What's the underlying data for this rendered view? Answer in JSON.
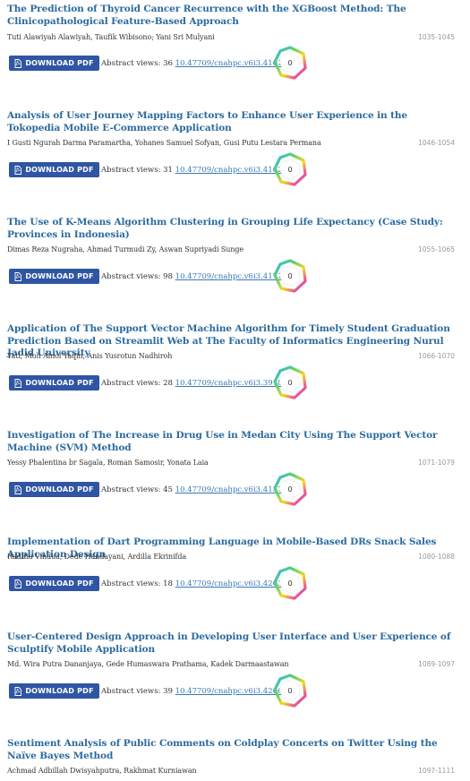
{
  "download_label": "DOWNLOAD PDF",
  "abstract_views_label": "Abstract views:",
  "articles": [
    {
      "title": "The Prediction of Thyroid Cancer Recurrence with the XGBoost Method: The Clinicopathological Feature-Based Approach",
      "authors": "Tuti Alawiyah Alawiyah, Taufik Wibisono; Yani Sri Mulyani",
      "pages": "1035-1045",
      "views": "36",
      "doi": "10.47709/cnahpc.v6i3.4101",
      "citations": "0"
    },
    {
      "title": "Analysis of User Journey Mapping Factors to Enhance User Experience in the Tokopedia Mobile E-Commerce Application",
      "authors": "I Gusti Ngurah Darma Paramartha, Yohanes Samuel Sofyan, Gusi Putu Lestara Permana",
      "pages": "1046-1054",
      "views": "31",
      "doi": "10.47709/cnahpc.v6i3.4162",
      "citations": "0"
    },
    {
      "title": "The Use of K-Means Algorithm Clustering in Grouping Life Expectancy (Case Study: Provinces in Indonesia)",
      "authors": "Dimas Reza Nugraha, Ahmad Turmudi Zy, Aswan Supriyadi Sunge",
      "pages": "1055-1065",
      "views": "98",
      "doi": "10.47709/cnahpc.v6i3.4171",
      "citations": "0"
    },
    {
      "title": "Application of The Support Vector Machine Algorithm for Timely Student Graduation Prediction Based on Streamlit Web at The Faculty of Informatics Engineering Nurul Jadid University",
      "authors": "Yati, Moh Ainol Yaqin, Anis Yusrotun Nadhiroh",
      "pages": "1066-1070",
      "views": "28",
      "doi": "10.47709/cnahpc.v6i3.3918",
      "citations": "0"
    },
    {
      "title": "Investigation of The Increase in Drug Use in Medan City Using The Support Vector Machine (SVM) Method",
      "authors": "Yessy Phalentina br Sagala, Roman Samosir, Yonata Laia",
      "pages": "1071-1079",
      "views": "45",
      "doi": "10.47709/cnahpc.v6i3.4137",
      "citations": "0"
    },
    {
      "title": "Implementation of Dart Programming Language in Mobile-Based DRs Snack Sales Application Design",
      "authors": "Raditia Vindua, Dede Handayani, Ardilla Ekrinifda",
      "pages": "1080-1088",
      "views": "18",
      "doi": "10.47709/cnahpc.v6i3.4203",
      "citations": "0"
    },
    {
      "title": "User-Centered Design Approach in Developing User Interface and User Experience of Sculptify Mobile Application",
      "authors": "Md. Wira Putra Dananjaya, Gede Humaswara Prathama, Kadek Darmaastawan",
      "pages": "1089-1097",
      "views": "39",
      "doi": "10.47709/cnahpc.v6i3.4206",
      "citations": "0"
    },
    {
      "title": "Sentiment Analysis of Public Comments on Coldplay Concerts on Twitter Using the Naïve Bayes Method",
      "authors": "Achmad Adbillah Dwisyahputra, Rakhmat Kurniawan",
      "pages": "1097-1111",
      "views": "",
      "doi": "",
      "citations": ""
    }
  ]
}
